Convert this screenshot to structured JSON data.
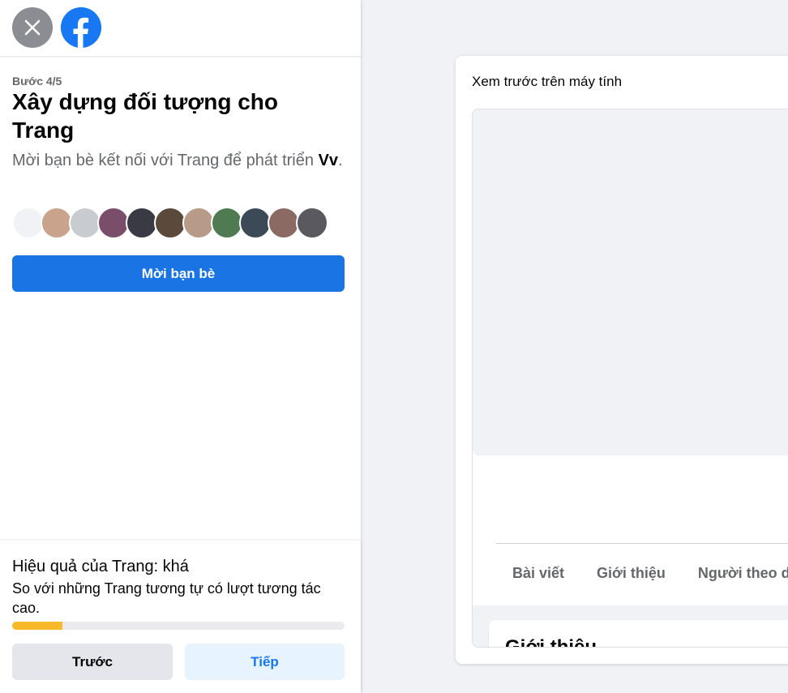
{
  "header": {
    "close_icon": "close-icon",
    "logo": "facebook-logo"
  },
  "wizard": {
    "step": "Bước 4/5",
    "title": "Xây dựng đối tượng cho Trang",
    "subtitle_prefix": "Mời bạn bè kết nối với Trang để phát triển ",
    "page_name": "Vv",
    "subtitle_suffix": ".",
    "invite_button": "Mời bạn bè"
  },
  "friends": [
    {
      "name": "friend-1",
      "color": "#f0f2f5"
    },
    {
      "name": "friend-2",
      "color": "#c9a38c"
    },
    {
      "name": "friend-3",
      "color": "#c8ccd1"
    },
    {
      "name": "friend-4",
      "color": "#7a4e6b"
    },
    {
      "name": "friend-5",
      "color": "#3a3a44"
    },
    {
      "name": "friend-6",
      "color": "#5b4a3b"
    },
    {
      "name": "friend-7",
      "color": "#b89a88"
    },
    {
      "name": "friend-8",
      "color": "#4f7a52"
    },
    {
      "name": "friend-9",
      "color": "#3c4a57"
    },
    {
      "name": "friend-10",
      "color": "#8a6a62"
    },
    {
      "name": "friend-11",
      "color": "#59595f"
    }
  ],
  "performance": {
    "title": "Hiệu quả của Trang: khá",
    "description": "So với những Trang tương tự có lượt tương tác cao.",
    "progress": 0.15,
    "progress_color": "#f7b928"
  },
  "footer": {
    "prev_button": "Trước",
    "next_button": "Tiếp"
  },
  "preview": {
    "title": "Xem trước trên máy tính",
    "tabs": [
      "Bài viết",
      "Giới thiệu",
      "Người theo d"
    ],
    "intro_heading": "Giới thiệu"
  },
  "colors": {
    "accent": "#1b74e4",
    "secondary_bg": "#e4e6eb",
    "next_bg": "#e7f3ff"
  }
}
